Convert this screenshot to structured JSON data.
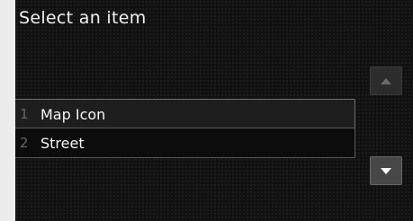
{
  "screen": {
    "title": "Select an item"
  },
  "list": {
    "items": [
      {
        "number": "1",
        "label": "Map Icon"
      },
      {
        "number": "2",
        "label": "Street"
      }
    ]
  },
  "scroll": {
    "up_icon": "triangle-up-icon",
    "down_icon": "triangle-down-icon",
    "up_enabled": false,
    "down_enabled": true
  },
  "colors": {
    "background": "#111111",
    "text": "#f2f2f2",
    "item_number": "#666666",
    "selected_item_bg": "#1e1e1e"
  }
}
